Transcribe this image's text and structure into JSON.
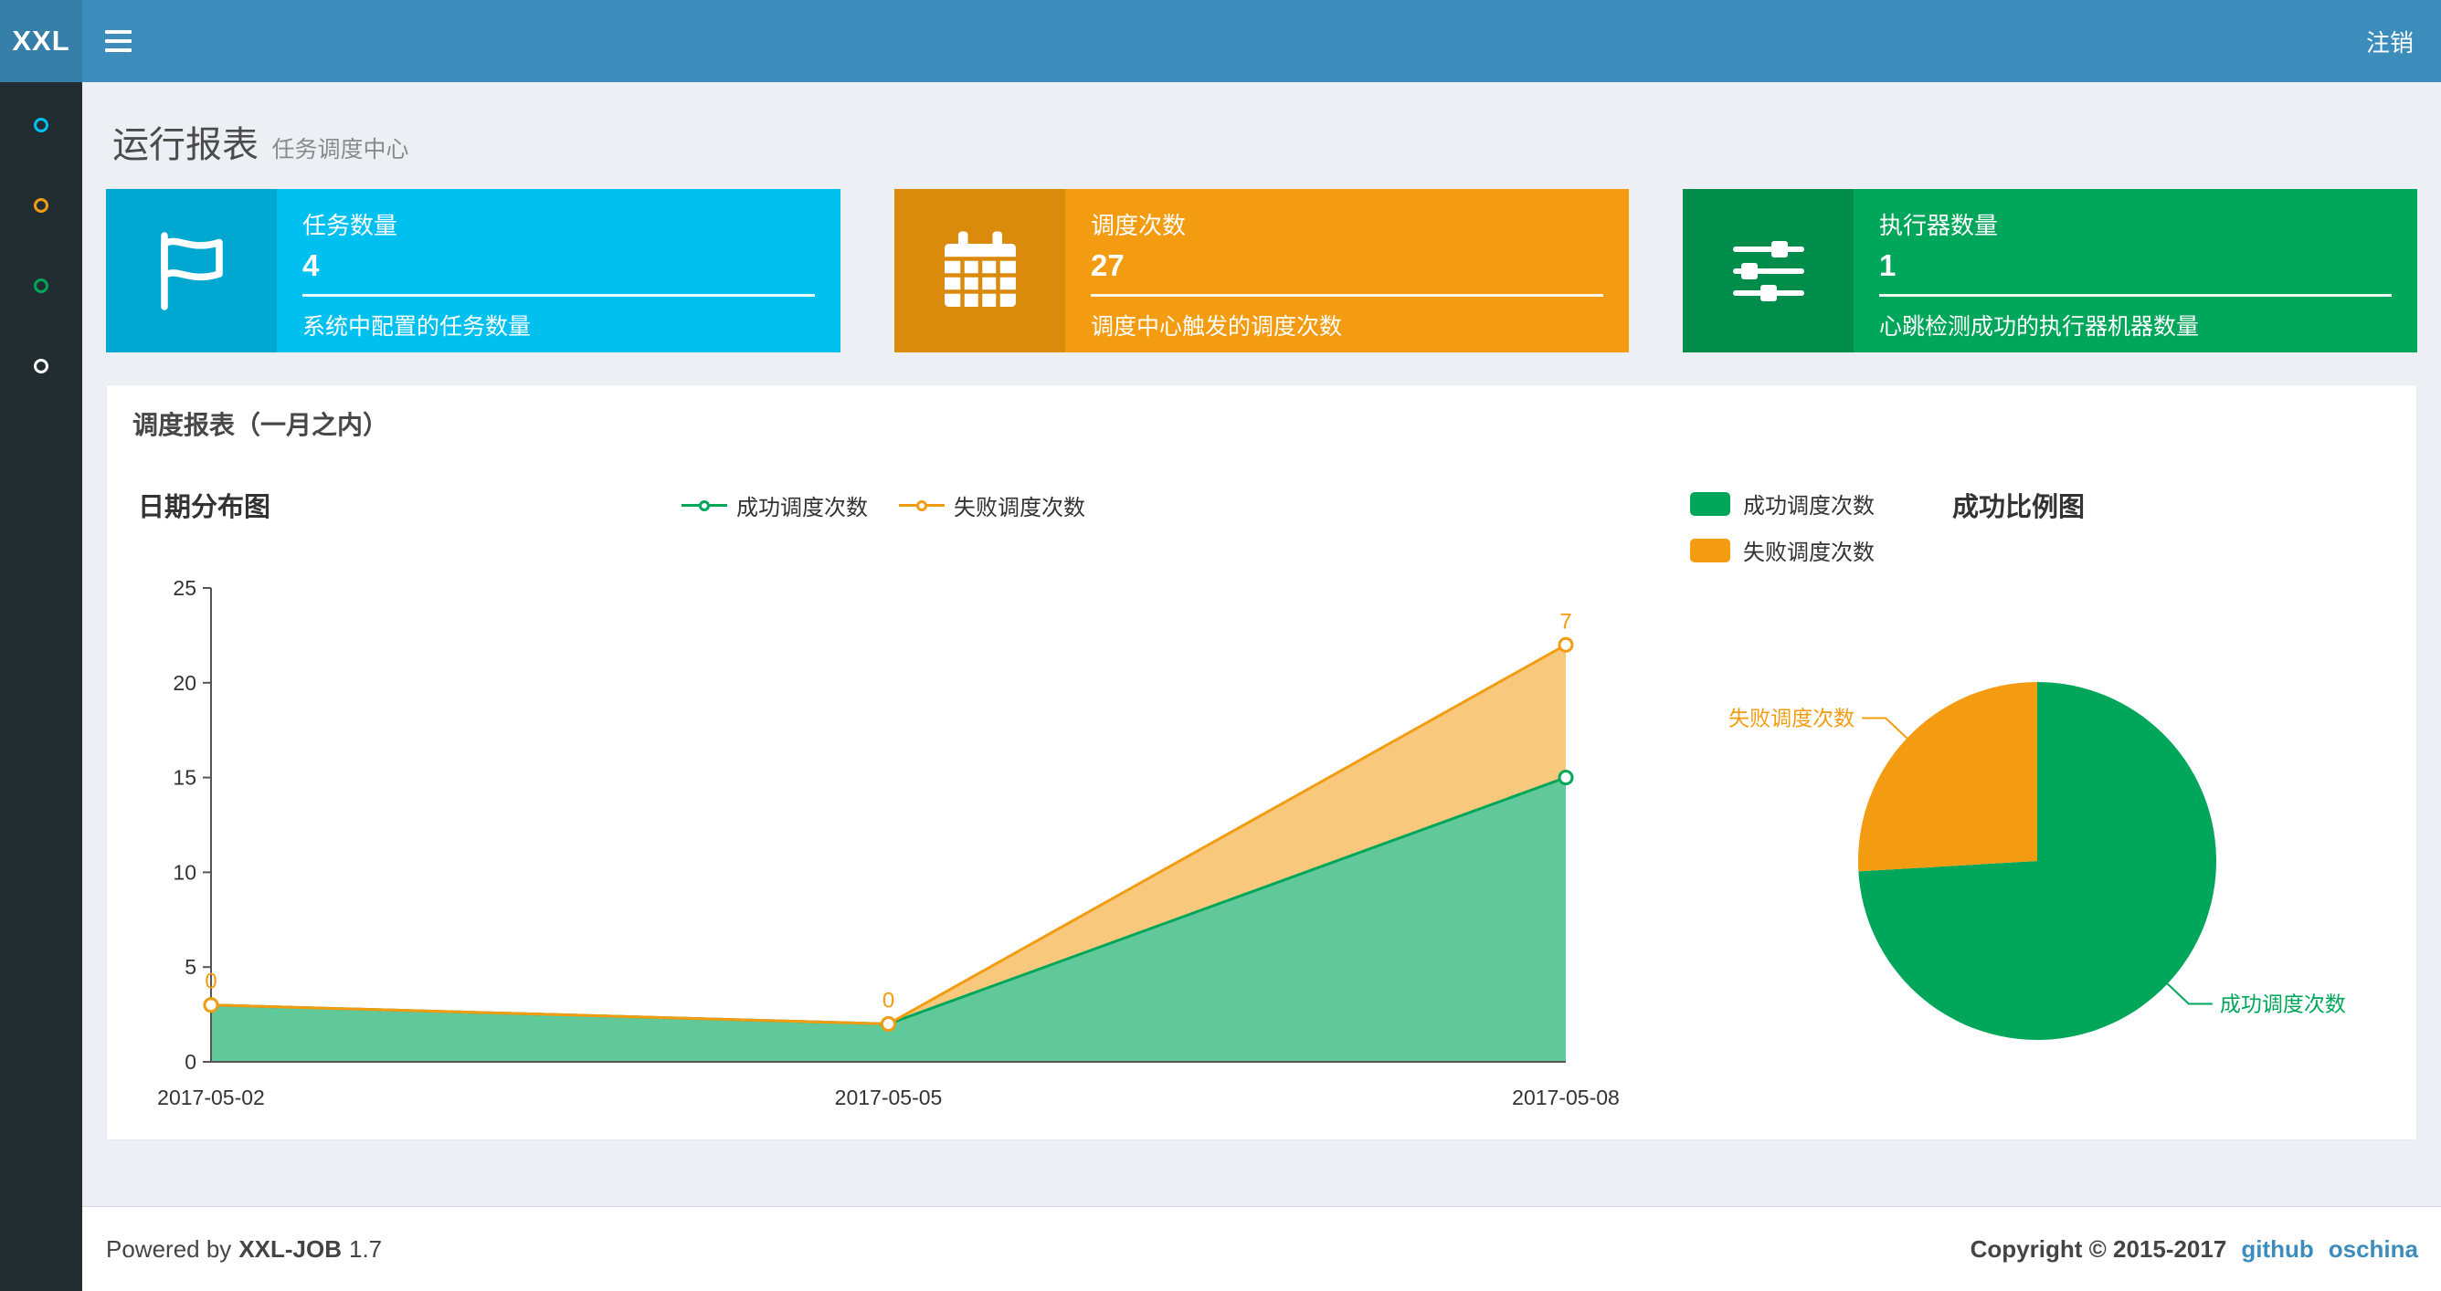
{
  "header": {
    "logo": "XXL",
    "logout_label": "注销"
  },
  "sidebar": {
    "items": [
      {
        "color": "#00c0ef"
      },
      {
        "color": "#f39c12"
      },
      {
        "color": "#00a65a"
      },
      {
        "color": "#ffffff"
      }
    ]
  },
  "page": {
    "title": "运行报表",
    "subtitle": "任务调度中心"
  },
  "info_boxes": [
    {
      "title": "任务数量",
      "value": "4",
      "desc": "系统中配置的任务数量",
      "bg": "#00c0ef",
      "icon_bg": "#00a7d0",
      "icon": "flag-icon"
    },
    {
      "title": "调度次数",
      "value": "27",
      "desc": "调度中心触发的调度次数",
      "bg": "#f39c12",
      "icon_bg": "#db8b0b",
      "icon": "calendar-icon"
    },
    {
      "title": "执行器数量",
      "value": "1",
      "desc": "心跳检测成功的执行器机器数量",
      "bg": "#00a65a",
      "icon_bg": "#008d4c",
      "icon": "sliders-icon"
    }
  ],
  "panel": {
    "title": "调度报表（一月之内）"
  },
  "chart_data": [
    {
      "type": "area",
      "title": "日期分布图",
      "x": [
        "2017-05-02",
        "2017-05-05",
        "2017-05-08"
      ],
      "stacked": true,
      "ylim": [
        0,
        25
      ],
      "yticks": [
        0,
        5,
        10,
        15,
        20,
        25
      ],
      "series": [
        {
          "name": "成功调度次数",
          "color": "#00a65a",
          "values": [
            3,
            2,
            15
          ]
        },
        {
          "name": "失败调度次数",
          "color": "#f39c12",
          "values": [
            0,
            0,
            7
          ]
        }
      ],
      "point_labels": {
        "series": "失败调度次数",
        "values": [
          "0",
          "0",
          "7"
        ]
      },
      "legend_position": "top",
      "grid": false
    },
    {
      "type": "pie",
      "title": "成功比例图",
      "legend": [
        "成功调度次数",
        "失败调度次数"
      ],
      "legend_position": "left",
      "slices": [
        {
          "label": "成功调度次数",
          "value": 20,
          "color": "#00a65a"
        },
        {
          "label": "失败调度次数",
          "value": 7,
          "color": "#f39c12"
        }
      ]
    }
  ],
  "footer": {
    "powered_prefix": "Powered by",
    "product": "XXL-JOB",
    "version": "1.7",
    "copyright": "Copyright © 2015-2017",
    "links": [
      {
        "label": "github"
      },
      {
        "label": "oschina"
      }
    ]
  }
}
